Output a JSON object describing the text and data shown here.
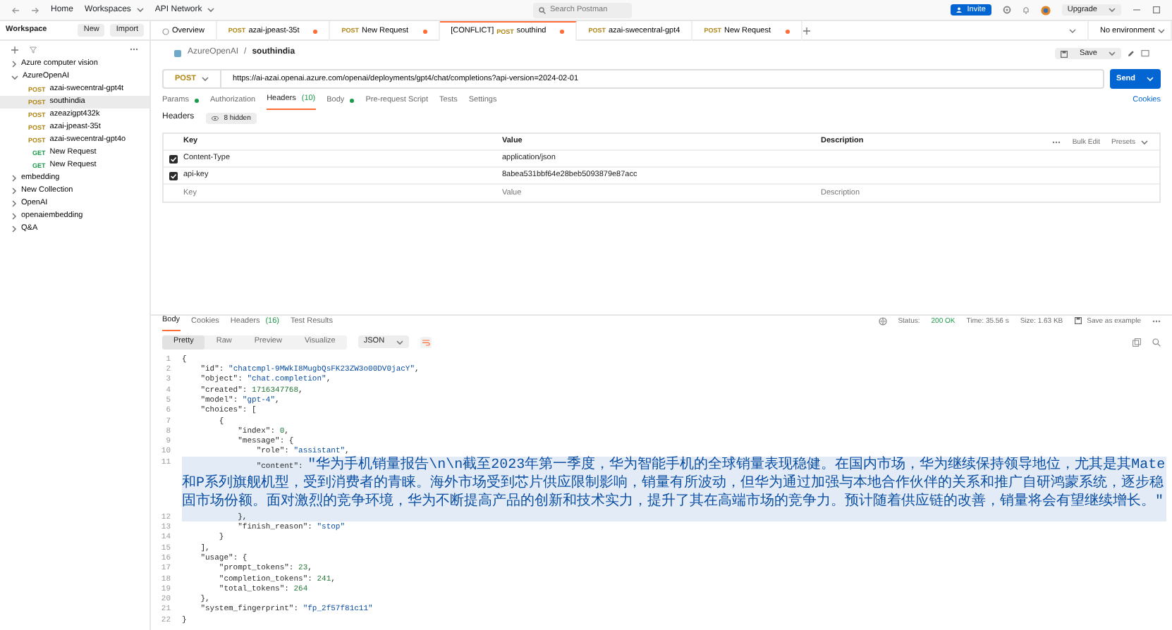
{
  "top_bar": {
    "nav": [
      "Home",
      "Workspaces",
      "API Network"
    ],
    "search": {
      "placeholder": "Search Postman"
    },
    "invite": "Invite",
    "upgrade": "Upgrade"
  },
  "sidebar": {
    "title": "Workspace",
    "buttons": [
      "New",
      "Import"
    ],
    "tree": [
      {
        "label": "Azure computer vision",
        "expanded": false,
        "selected": false
      },
      {
        "label": "AzureOpenAI",
        "expanded": true,
        "selected": false,
        "children": [
          {
            "method": "POST",
            "color": "#b08512",
            "label": "azai-swecentral-gpt4t",
            "selected": false
          },
          {
            "method": "POST",
            "color": "#b08512",
            "label": "southindia",
            "selected": true
          },
          {
            "method": "POST",
            "color": "#b08512",
            "label": "azeazigpt432k",
            "selected": false
          },
          {
            "method": "POST",
            "color": "#b08512",
            "label": "azai-jpeast-35t",
            "selected": false
          },
          {
            "method": "POST",
            "color": "#b08512",
            "label": "azai-swecentral-gpt4o",
            "selected": false
          },
          {
            "method": "GET",
            "color": "#1f9a4d",
            "label": "New Request",
            "selected": false
          },
          {
            "method": "GET",
            "color": "#1f9a4d",
            "label": "New Request",
            "selected": false
          }
        ]
      },
      {
        "label": "embedding",
        "expanded": false,
        "selected": false
      },
      {
        "label": "New Collection",
        "expanded": false,
        "selected": false
      },
      {
        "label": "OpenAI",
        "expanded": false,
        "selected": false
      },
      {
        "label": "openaiembedding",
        "expanded": false,
        "selected": false
      },
      {
        "label": "Q&A",
        "expanded": false,
        "selected": false
      }
    ]
  },
  "tabs": [
    {
      "kind": "overview",
      "label": "Overview",
      "selected": false,
      "unsaved": false
    },
    {
      "kind": "request",
      "method": "POST",
      "color": "#b08512",
      "label": "azai-jpeast-35t",
      "selected": false,
      "unsaved": true
    },
    {
      "kind": "request",
      "method": "POST",
      "color": "#b08512",
      "label": "New Request",
      "selected": false,
      "unsaved": true
    },
    {
      "kind": "request",
      "prefix": "[CONFLICT]",
      "method": "POST",
      "color": "#b08512",
      "label": "southind",
      "selected": true,
      "unsaved": true
    },
    {
      "kind": "request",
      "method": "POST",
      "color": "#b08512",
      "label": "azai-swecentral-gpt4",
      "selected": false,
      "unsaved": false
    },
    {
      "kind": "request",
      "method": "POST",
      "color": "#b08512",
      "label": "New Request",
      "selected": false,
      "unsaved": true
    }
  ],
  "environment": "No environment",
  "breadcrumb": [
    "AzureOpenAI",
    "southindia"
  ],
  "breadcrumb_separator": "/",
  "save": "Save",
  "request": {
    "method": "POST",
    "url": "https://ai-azai.openai.azure.com/openai/deployments/gpt4/chat/completions?api-version=2024-02-01",
    "send": "Send"
  },
  "request_tabs": [
    {
      "label": "Params",
      "dot": true,
      "selected": false
    },
    {
      "label": "Authorization",
      "dot": false,
      "selected": false
    },
    {
      "label": "Headers",
      "count": "(10)",
      "dot": false,
      "selected": true
    },
    {
      "label": "Body",
      "dot": true,
      "selected": false
    },
    {
      "label": "Pre-request Script",
      "dot": false,
      "selected": false
    },
    {
      "label": "Tests",
      "dot": false,
      "selected": false
    },
    {
      "label": "Settings",
      "dot": false,
      "selected": false
    }
  ],
  "cookies": "Cookies",
  "headers_label": "Headers",
  "hidden": "8 hidden",
  "headers_table": {
    "columns": [
      "Key",
      "Value",
      "Description"
    ],
    "actions": [
      "Bulk Edit",
      "Presets"
    ],
    "rows": [
      {
        "enabled": true,
        "key": "Content-Type",
        "value": "application/json"
      },
      {
        "enabled": true,
        "key": "api-key",
        "value": "8abea531bbf64e28beb5093879e87acc"
      }
    ],
    "new_row": [
      {
        "placeholder": "Key"
      },
      {
        "placeholder": "Value"
      },
      {
        "placeholder": "Description"
      }
    ]
  },
  "response": {
    "tabs": [
      {
        "label": "Body",
        "selected": true
      },
      {
        "label": "Cookies",
        "selected": false
      },
      {
        "label": "Headers",
        "count": "(16)",
        "selected": false
      },
      {
        "label": "Test Results",
        "selected": false
      }
    ],
    "status_label": "Status:",
    "status": "200 OK",
    "time": "Time: 35.56 s",
    "size": "Size: 1.63 KB",
    "save_example": "Save as example",
    "views": [
      {
        "label": "Pretty",
        "selected": true
      },
      {
        "label": "Raw",
        "selected": false
      },
      {
        "label": "Preview",
        "selected": false
      },
      {
        "label": "Visualize",
        "selected": false
      }
    ],
    "format": "JSON",
    "lines": [
      {
        "number": "1",
        "text": "{",
        "highlighted": false
      },
      {
        "number": "2",
        "text": "    \"id\": \"chatcmpl-9MWkI8MugbQsFK23ZW3o00DV0jacY\",",
        "highlighted": false
      },
      {
        "number": "3",
        "text": "    \"object\": \"chat.completion\",",
        "highlighted": false
      },
      {
        "number": "4",
        "text": "    \"created\": 1716347768,",
        "highlighted": false
      },
      {
        "number": "5",
        "text": "    \"model\": \"gpt-4\",",
        "highlighted": false
      },
      {
        "number": "6",
        "text": "    \"choices\": [",
        "highlighted": false
      },
      {
        "number": "7",
        "text": "        {",
        "highlighted": false
      },
      {
        "number": "8",
        "text": "            \"index\": 0,",
        "highlighted": false
      },
      {
        "number": "9",
        "text": "            \"message\": {",
        "highlighted": false
      },
      {
        "number": "10",
        "text": "                \"role\": \"assistant\",",
        "highlighted": false
      },
      {
        "number": "11",
        "text": "                \"content\": \"华为手机销量报告\\n\\n截至2023年第一季度，华为智能手机的全球销量表现稳健。在国内市场，华为继续保持领导地位，尤其是其Mate和P系列旗舰机型，受到消费者的青睐。海外市场受到芯片供应限制影响，销量有所波动，但华为通过加强与本地合作伙伴的关系和推广自研鸿蒙系统，逐步稳固市场份额。面对激烈的竞争环境，华为不断提高产品的创新和技术实力，提升了其在高端市场的竞争力。预计随着供应链的改善，销量将会有望继续增长。\"",
        "highlighted": true
      },
      {
        "number": "12",
        "text": "            },",
        "highlighted": true
      },
      {
        "number": "13",
        "text": "            \"finish_reason\": \"stop\"",
        "highlighted": false
      },
      {
        "number": "14",
        "text": "        }",
        "highlighted": false
      },
      {
        "number": "15",
        "text": "    ],",
        "highlighted": false
      },
      {
        "number": "16",
        "text": "    \"usage\": {",
        "highlighted": false
      },
      {
        "number": "17",
        "text": "        \"prompt_tokens\": 23,",
        "highlighted": false
      },
      {
        "number": "18",
        "text": "        \"completion_tokens\": 241,",
        "highlighted": false
      },
      {
        "number": "19",
        "text": "        \"total_tokens\": 264",
        "highlighted": false
      },
      {
        "number": "20",
        "text": "    },",
        "highlighted": false
      },
      {
        "number": "21",
        "text": "    \"system_fingerprint\": \"fp_2f57f81c11\"",
        "highlighted": false
      },
      {
        "number": "22",
        "text": "}",
        "highlighted": false
      }
    ]
  }
}
